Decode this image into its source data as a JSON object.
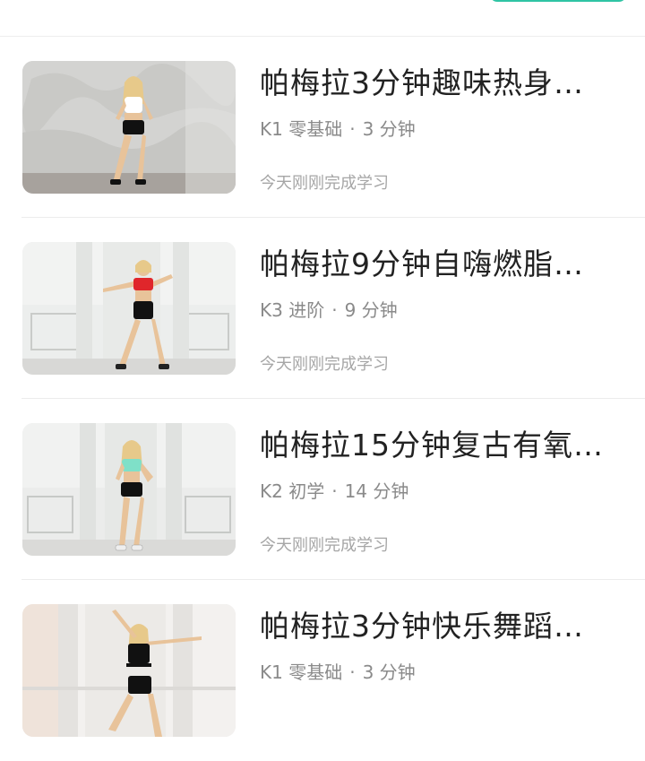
{
  "courses": [
    {
      "title": "帕梅拉3分钟趣味热身…",
      "level": "K1 零基础",
      "duration": "3 分钟",
      "status": "今天刚刚完成学习",
      "scene": "grunge-wall",
      "top_color": "#ffffff"
    },
    {
      "title": "帕梅拉9分钟自嗨燃脂…",
      "level": "K3 进阶",
      "duration": "9 分钟",
      "status": "今天刚刚完成学习",
      "scene": "white-room",
      "top_color": "#e0262b"
    },
    {
      "title": "帕梅拉15分钟复古有氧…",
      "level": "K2 初学",
      "duration": "14 分钟",
      "status": "今天刚刚完成学习",
      "scene": "white-room",
      "top_color": "#7fe0c8"
    },
    {
      "title": "帕梅拉3分钟快乐舞蹈…",
      "level": "K1 零基础",
      "duration": "3 分钟",
      "status": "",
      "scene": "white-room",
      "top_color": "#111111"
    }
  ],
  "separator": "·",
  "colors": {
    "accent": "#2fc4a4"
  }
}
